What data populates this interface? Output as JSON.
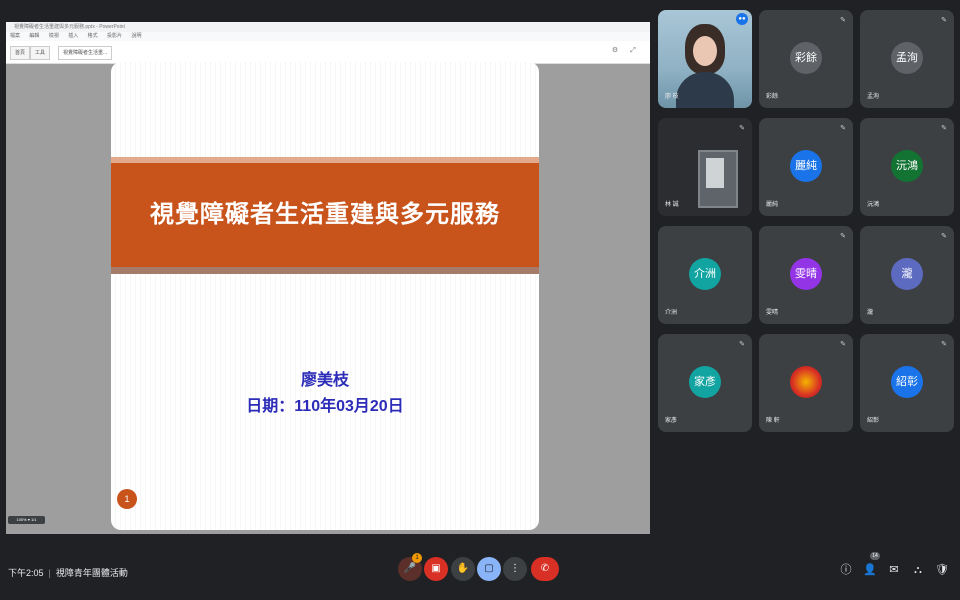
{
  "presentation": {
    "window_title": "視覺障礙者生活重建與多元服務.pptx - PowerPoint",
    "menu": [
      "檔案",
      "編輯",
      "檢視",
      "插入",
      "格式",
      "投影片",
      "說明"
    ],
    "tabs": [
      "首頁",
      "工具",
      "視覺障礙者生活重..."
    ],
    "slide": {
      "title": "視覺障礙者生活重建與多元服務",
      "author": "廖美枝",
      "date": "日期：110年03月20日",
      "page_number": "1"
    },
    "status_pill": "100% ▾ 1/1"
  },
  "participants": [
    {
      "name": "廖 枝",
      "initials": "",
      "color": "",
      "video": "person"
    },
    {
      "name": "彩餘",
      "initials": "彩餘",
      "color": "#5f6368"
    },
    {
      "name": "孟洵",
      "initials": "孟洵",
      "color": "#5f6368"
    },
    {
      "name": "林 誠",
      "initials": "",
      "color": "",
      "video": "room"
    },
    {
      "name": "麗純",
      "initials": "麗純",
      "color": "#1a73e8"
    },
    {
      "name": "沅鴻",
      "initials": "沅鴻",
      "color": "#137333"
    },
    {
      "name": "介洲",
      "initials": "介洲",
      "color": "#12a4a1"
    },
    {
      "name": "雯晴",
      "initials": "雯晴",
      "color": "#9334e6"
    },
    {
      "name": "瀧",
      "initials": "瀧",
      "color": "#5c6bc0"
    },
    {
      "name": "家彥",
      "initials": "家彥",
      "color": "#12a4a1"
    },
    {
      "name": "陳 軒",
      "initials": "",
      "color": "#d93025",
      "video": "logo"
    },
    {
      "name": "紹彰",
      "initials": "紹彰",
      "color": "#1a73e8"
    }
  ],
  "bottom_bar": {
    "time": "下午2:05",
    "meeting_name": "視障青年團體活動",
    "controls": [
      "mic-off",
      "camera-off",
      "raise-hand",
      "present",
      "more",
      "leave"
    ],
    "raise_hand_count": "1",
    "participant_count": "14",
    "right_icons": [
      "info",
      "people",
      "chat",
      "activities",
      "host-controls"
    ]
  },
  "colors": {
    "background": "#202124",
    "tile": "#3c4043",
    "banner": "#c8531b",
    "slide_text": "#2c2cb8",
    "leave": "#d93025"
  }
}
